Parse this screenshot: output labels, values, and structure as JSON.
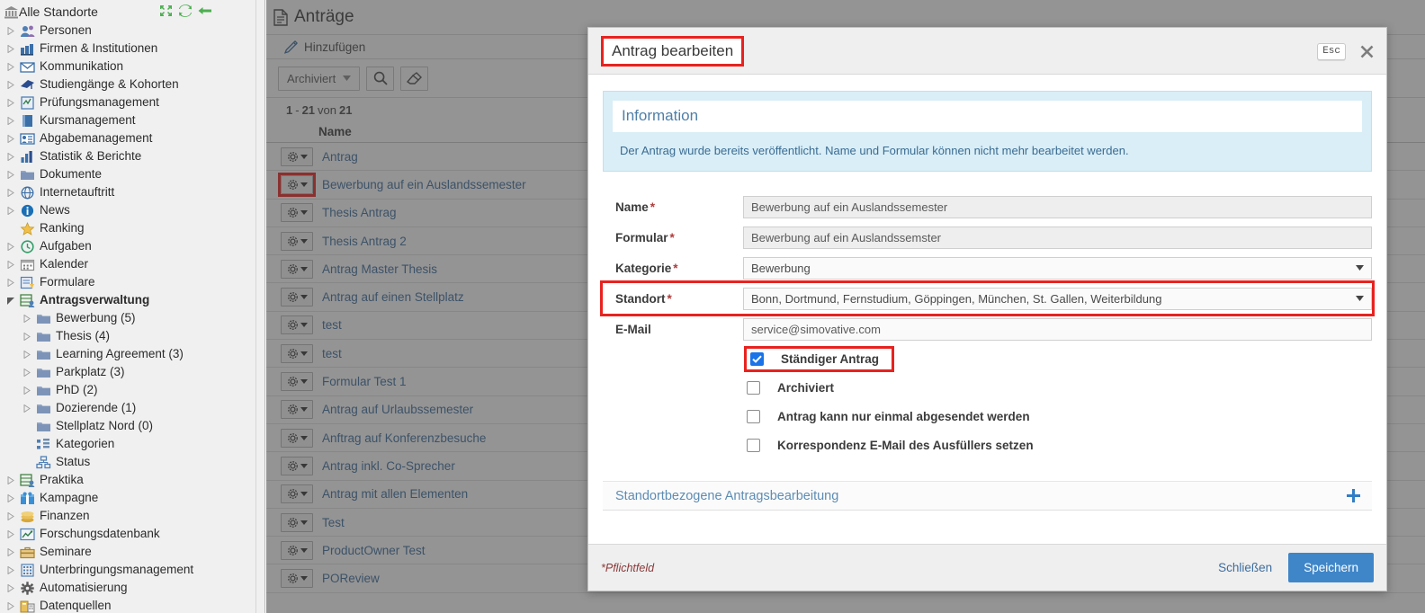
{
  "sidebar": {
    "root": {
      "label": "Alle Standorte",
      "icon": "bank-icon"
    },
    "tools": [
      {
        "name": "collapse-all-icon",
        "title": "collapse"
      },
      {
        "name": "refresh-icon",
        "title": "refresh"
      },
      {
        "name": "back-arrow-icon",
        "title": "back"
      }
    ],
    "items": [
      {
        "label": "Personen",
        "icon": "people-icon",
        "level": 0,
        "twisty": "closed"
      },
      {
        "label": "Firmen & Institutionen",
        "icon": "factory-icon",
        "level": 0,
        "twisty": "closed"
      },
      {
        "label": "Kommunikation",
        "icon": "envelope-icon",
        "level": 0,
        "twisty": "closed"
      },
      {
        "label": "Studiengänge & Kohorten",
        "icon": "graduation-icon",
        "level": 0,
        "twisty": "closed"
      },
      {
        "label": "Prüfungsmanagement",
        "icon": "exam-icon",
        "level": 0,
        "twisty": "closed"
      },
      {
        "label": "Kursmanagement",
        "icon": "book-icon",
        "level": 0,
        "twisty": "closed"
      },
      {
        "label": "Abgabemanagement",
        "icon": "card-icon",
        "level": 0,
        "twisty": "closed"
      },
      {
        "label": "Statistik & Berichte",
        "icon": "bar-chart-icon",
        "level": 0,
        "twisty": "closed"
      },
      {
        "label": "Dokumente",
        "icon": "folder-icon",
        "level": 0,
        "twisty": "closed"
      },
      {
        "label": "Internetauftritt",
        "icon": "globe-icon",
        "level": 0,
        "twisty": "closed"
      },
      {
        "label": "News",
        "icon": "info-icon",
        "level": 0,
        "twisty": "closed"
      },
      {
        "label": "Ranking",
        "icon": "star-icon",
        "level": 0,
        "twisty": "none"
      },
      {
        "label": "Aufgaben",
        "icon": "clock-icon",
        "level": 0,
        "twisty": "closed"
      },
      {
        "label": "Kalender",
        "icon": "calendar-icon",
        "level": 0,
        "twisty": "closed"
      },
      {
        "label": "Formulare",
        "icon": "form-icon",
        "level": 0,
        "twisty": "closed"
      },
      {
        "label": "Antragsverwaltung",
        "icon": "application-icon",
        "level": 0,
        "twisty": "open",
        "bold": true
      },
      {
        "label": "Bewerbung (5)",
        "icon": "folder-icon",
        "level": 1,
        "twisty": "closed"
      },
      {
        "label": "Thesis (4)",
        "icon": "folder-icon",
        "level": 1,
        "twisty": "closed"
      },
      {
        "label": "Learning Agreement (3)",
        "icon": "folder-icon",
        "level": 1,
        "twisty": "closed"
      },
      {
        "label": "Parkplatz (3)",
        "icon": "folder-icon",
        "level": 1,
        "twisty": "closed"
      },
      {
        "label": "PhD (2)",
        "icon": "folder-icon",
        "level": 1,
        "twisty": "closed"
      },
      {
        "label": "Dozierende (1)",
        "icon": "folder-icon",
        "level": 1,
        "twisty": "closed"
      },
      {
        "label": "Stellplatz Nord (0)",
        "icon": "folder-icon",
        "level": 1,
        "twisty": "none"
      },
      {
        "label": "Kategorien",
        "icon": "category-icon",
        "level": 1,
        "twisty": "none"
      },
      {
        "label": "Status",
        "icon": "status-icon",
        "level": 1,
        "twisty": "none"
      },
      {
        "label": "Praktika",
        "icon": "internship-icon",
        "level": 0,
        "twisty": "closed"
      },
      {
        "label": "Kampagne",
        "icon": "gift-icon",
        "level": 0,
        "twisty": "closed"
      },
      {
        "label": "Finanzen",
        "icon": "coins-icon",
        "level": 0,
        "twisty": "closed"
      },
      {
        "label": "Forschungsdatenbank",
        "icon": "trend-icon",
        "level": 0,
        "twisty": "closed"
      },
      {
        "label": "Seminare",
        "icon": "briefcase-icon",
        "level": 0,
        "twisty": "closed"
      },
      {
        "label": "Unterbringungsmanagement",
        "icon": "building-icon",
        "level": 0,
        "twisty": "closed"
      },
      {
        "label": "Automatisierung",
        "icon": "gear-icon",
        "level": 0,
        "twisty": "closed"
      },
      {
        "label": "Datenquellen",
        "icon": "database-icon",
        "level": 0,
        "twisty": "closed"
      }
    ]
  },
  "list": {
    "title": "Anträge",
    "add_label": "Hinzufügen",
    "toolbar": {
      "filter_label": "Archiviert",
      "search_icon": "search-icon",
      "clear_icon": "eraser-icon"
    },
    "count": {
      "from": "1",
      "dash": "-",
      "to": "21",
      "von": "von",
      "total": "21"
    },
    "column_header": "Name",
    "rows": [
      {
        "name": "Antrag"
      },
      {
        "name": "Bewerbung auf ein Auslandssemester",
        "highlighted": true
      },
      {
        "name": "Thesis Antrag"
      },
      {
        "name": "Thesis Antrag 2"
      },
      {
        "name": "Antrag Master Thesis"
      },
      {
        "name": "Antrag auf einen Stellplatz"
      },
      {
        "name": "test"
      },
      {
        "name": "test"
      },
      {
        "name": "Formular Test 1"
      },
      {
        "name": "Antrag auf Urlaubssemester"
      },
      {
        "name": "Anftrag auf Konferenzbesuche"
      },
      {
        "name": "Antrag inkl. Co-Sprecher"
      },
      {
        "name": "Antrag mit allen Elementen"
      },
      {
        "name": "Test"
      },
      {
        "name": "ProductOwner Test"
      },
      {
        "name": "POReview"
      }
    ]
  },
  "modal": {
    "title": "Antrag bearbeiten",
    "esc_label": "Esc",
    "close_icon": "close-icon",
    "info": {
      "title": "Information",
      "text": "Der Antrag wurde bereits veröffentlicht. Name und Formular können nicht mehr bearbeitet werden."
    },
    "fields": [
      {
        "label": "Name",
        "required": true,
        "value": "Bewerbung auf ein Auslandssemester",
        "type": "text",
        "readonly": true
      },
      {
        "label": "Formular",
        "required": true,
        "value": "Bewerbung auf ein Auslandssemster",
        "type": "text",
        "readonly": true
      },
      {
        "label": "Kategorie",
        "required": true,
        "value": "Bewerbung",
        "type": "select"
      },
      {
        "label": "Standort",
        "required": true,
        "value": "Bonn, Dortmund, Fernstudium, Göppingen, München, St. Gallen, Weiterbildung",
        "type": "select",
        "highlighted": true
      },
      {
        "label": "E-Mail",
        "required": false,
        "value": "service@simovative.com",
        "type": "text"
      }
    ],
    "checkboxes": [
      {
        "label": "Ständiger Antrag",
        "checked": true,
        "highlighted": true
      },
      {
        "label": "Archiviert",
        "checked": false,
        "highlighted": false
      },
      {
        "label": "Antrag kann nur einmal abgesendet werden",
        "checked": false,
        "highlighted": false
      },
      {
        "label": "Korrespondenz E-Mail des Ausfüllers setzen",
        "checked": false,
        "highlighted": false
      }
    ],
    "accordion": {
      "label": "Standortbezogene Antragsbearbeitung",
      "expand_icon": "plus-icon"
    },
    "footer": {
      "mandatory_note": "*Pflichtfeld",
      "close_label": "Schließen",
      "save_label": "Speichern"
    }
  },
  "colors": {
    "accent_blue": "#3f86c8",
    "link_blue": "#3d6d9e",
    "highlight_red": "#e8221f",
    "checkbox_blue": "#1a73e8",
    "info_bg": "#d9eef7"
  }
}
